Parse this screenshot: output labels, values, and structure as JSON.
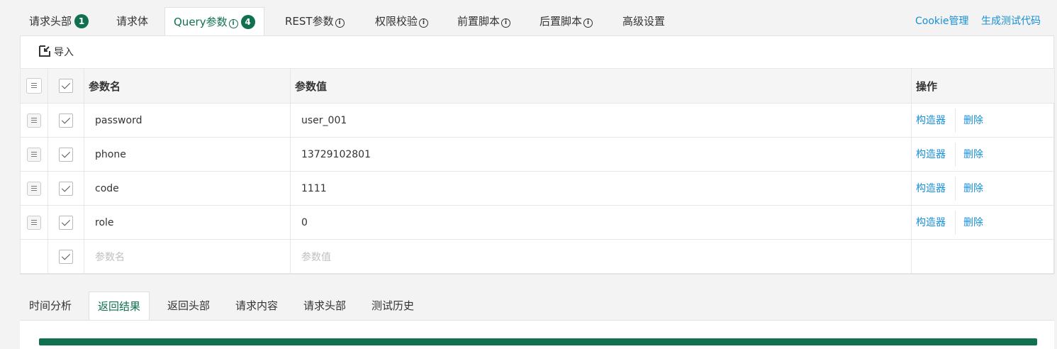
{
  "top_tabs": [
    {
      "label": "请求头部",
      "badge": "1"
    },
    {
      "label": "请求体"
    },
    {
      "label": "Query参数",
      "info": "i",
      "badge": "4"
    },
    {
      "label": "REST参数",
      "info": "i"
    },
    {
      "label": "权限校验",
      "info": "i"
    },
    {
      "label": "前置脚本",
      "info": "i"
    },
    {
      "label": "后置脚本",
      "info": "i"
    },
    {
      "label": "高级设置"
    }
  ],
  "top_links": {
    "cookie": "Cookie管理",
    "gen_code": "生成测试代码"
  },
  "toolbar": {
    "import_label": "导入"
  },
  "table": {
    "headers": {
      "name": "参数名",
      "value": "参数值",
      "ops": "操作"
    },
    "rows": [
      {
        "name": "password",
        "value": "user_001",
        "builder": "构造器",
        "delete": "删除"
      },
      {
        "name": "phone",
        "value": "13729102801",
        "builder": "构造器",
        "delete": "删除"
      },
      {
        "name": "code",
        "value": "1111",
        "builder": "构造器",
        "delete": "删除"
      },
      {
        "name": "role",
        "value": "0",
        "builder": "构造器",
        "delete": "删除"
      }
    ],
    "new_row": {
      "name_placeholder": "参数名",
      "value_placeholder": "参数值"
    }
  },
  "bottom_tabs": [
    "时间分析",
    "返回结果",
    "返回头部",
    "请求内容",
    "请求头部",
    "测试历史"
  ],
  "colors": {
    "accent": "#11704f",
    "link": "#1890d6"
  }
}
